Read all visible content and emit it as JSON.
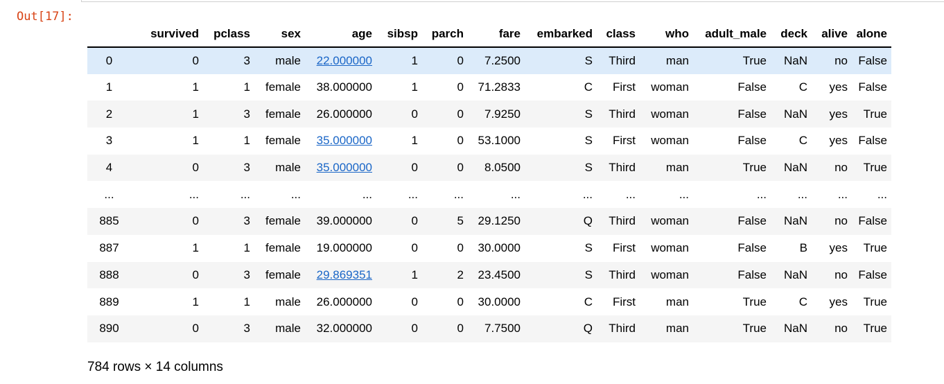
{
  "prompt": "Out[17]:",
  "columns": [
    "",
    "survived",
    "pclass",
    "sex",
    "age",
    "sibsp",
    "parch",
    "fare",
    "embarked",
    "class",
    "who",
    "adult_male",
    "deck",
    "alive",
    "alone"
  ],
  "rows": [
    [
      "0",
      "0",
      "3",
      "male",
      "22.000000",
      "1",
      "0",
      "7.2500",
      "S",
      "Third",
      "man",
      "True",
      "NaN",
      "no",
      "False"
    ],
    [
      "1",
      "1",
      "1",
      "female",
      "38.000000",
      "1",
      "0",
      "71.2833",
      "C",
      "First",
      "woman",
      "False",
      "C",
      "yes",
      "False"
    ],
    [
      "2",
      "1",
      "3",
      "female",
      "26.000000",
      "0",
      "0",
      "7.9250",
      "S",
      "Third",
      "woman",
      "False",
      "NaN",
      "yes",
      "True"
    ],
    [
      "3",
      "1",
      "1",
      "female",
      "35.000000",
      "1",
      "0",
      "53.1000",
      "S",
      "First",
      "woman",
      "False",
      "C",
      "yes",
      "False"
    ],
    [
      "4",
      "0",
      "3",
      "male",
      "35.000000",
      "0",
      "0",
      "8.0500",
      "S",
      "Third",
      "man",
      "True",
      "NaN",
      "no",
      "True"
    ],
    [
      "...",
      "...",
      "...",
      "...",
      "...",
      "...",
      "...",
      "...",
      "...",
      "...",
      "...",
      "...",
      "...",
      "...",
      "..."
    ],
    [
      "885",
      "0",
      "3",
      "female",
      "39.000000",
      "0",
      "5",
      "29.1250",
      "Q",
      "Third",
      "woman",
      "False",
      "NaN",
      "no",
      "False"
    ],
    [
      "887",
      "1",
      "1",
      "female",
      "19.000000",
      "0",
      "0",
      "30.0000",
      "S",
      "First",
      "woman",
      "False",
      "B",
      "yes",
      "True"
    ],
    [
      "888",
      "0",
      "3",
      "female",
      "29.869351",
      "1",
      "2",
      "23.4500",
      "S",
      "Third",
      "woman",
      "False",
      "NaN",
      "no",
      "False"
    ],
    [
      "889",
      "1",
      "1",
      "male",
      "26.000000",
      "0",
      "0",
      "30.0000",
      "C",
      "First",
      "man",
      "True",
      "C",
      "yes",
      "True"
    ],
    [
      "890",
      "0",
      "3",
      "male",
      "32.000000",
      "0",
      "0",
      "7.7500",
      "Q",
      "Third",
      "man",
      "True",
      "NaN",
      "no",
      "True"
    ]
  ],
  "linked_age_rows": [
    0,
    3,
    4,
    8
  ],
  "highlighted_row": 0,
  "footer": "784 rows × 14 columns",
  "colors": {
    "prompt": "#D84315",
    "link": "#1a66c7",
    "row_stripe": "#f5f5f5",
    "row_highlight": "#dcebfa"
  }
}
